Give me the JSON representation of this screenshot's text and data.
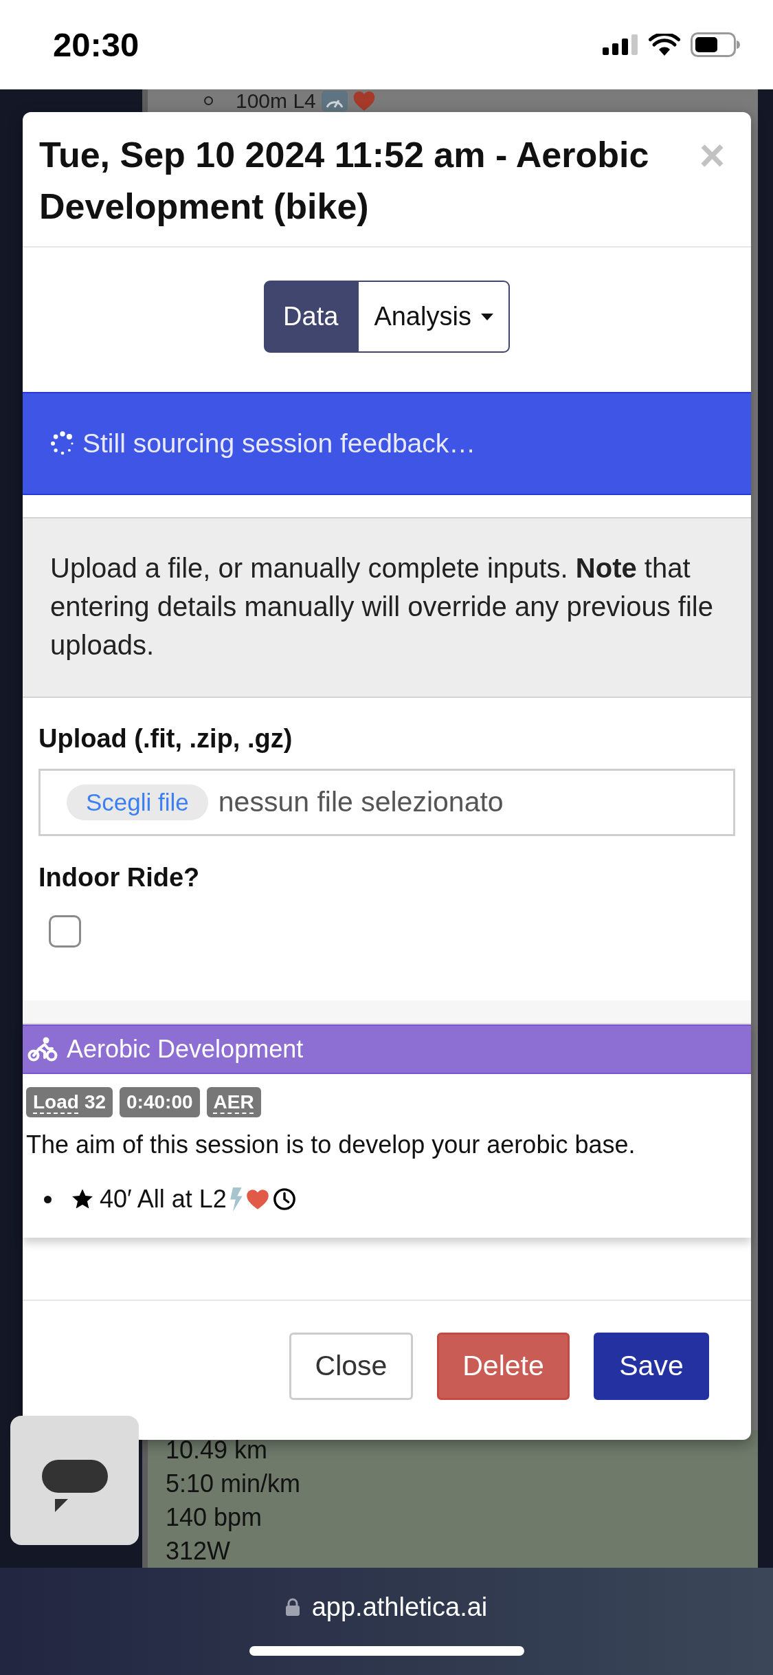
{
  "status_bar": {
    "time": "20:30"
  },
  "background": {
    "step": {
      "text": "100m L4"
    },
    "stats": [
      "10.49 km",
      "5:10 min/km",
      "140 bpm",
      "312W"
    ]
  },
  "modal": {
    "title": "Tue, Sep 10 2024 11:52 am - Aerobic Development (bike)",
    "close": "×",
    "tabs": [
      {
        "label": "Data",
        "kind": "tab",
        "selected": true
      },
      {
        "label": "Analysis",
        "kind": "dropdown",
        "selected": false
      }
    ],
    "alert": {
      "text": "Still sourcing session feedback…"
    },
    "info": "Upload a file, or manually complete inputs. **Note** that entering details manually will override any previous file uploads.",
    "upload": {
      "label": "Upload (.fit, .zip, .gz)",
      "button": "Scegli file",
      "value": "nessun file selezionato"
    },
    "indoor": {
      "label": "Indoor Ride?",
      "checked": false
    },
    "session": {
      "title": "Aerobic Development",
      "badges": [
        {
          "abbr": "Load",
          "text": "32"
        },
        {
          "text": "0:40:00"
        },
        {
          "abbr": "AER"
        }
      ],
      "description": "The aim of this session is to develop your aerobic base.",
      "steps": [
        {
          "text": "40′ All at L2"
        }
      ]
    },
    "buttons": [
      {
        "label": "Close",
        "kind": "default"
      },
      {
        "label": "Delete",
        "kind": "danger"
      },
      {
        "label": "Save",
        "kind": "primary"
      }
    ]
  },
  "browser_bar": {
    "url": "app.athletica.ai"
  }
}
